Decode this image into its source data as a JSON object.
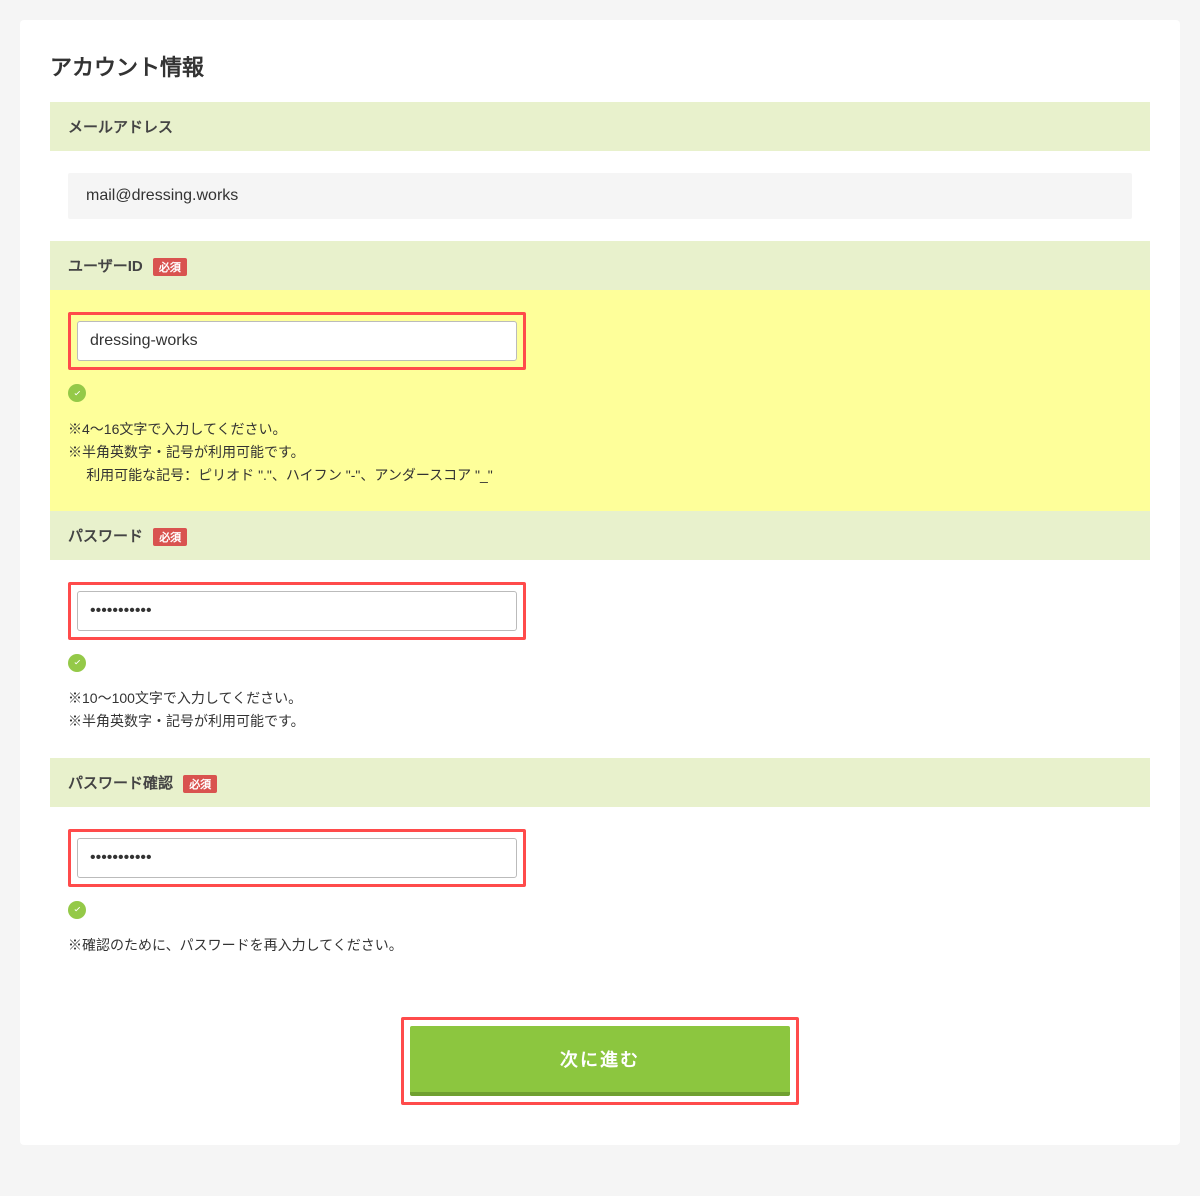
{
  "page_title": "アカウント情報",
  "required_label": "必須",
  "sections": {
    "email": {
      "label": "メールアドレス",
      "value": "mail@dressing.works"
    },
    "user_id": {
      "label": "ユーザーID",
      "required": true,
      "value": "dressing-works",
      "help": [
        "※4〜16文字で入力してください。",
        "※半角英数字・記号が利用可能です。",
        "利用可能な記号：ピリオド \".\"、ハイフン \"-\"、アンダースコア \"_\""
      ]
    },
    "password": {
      "label": "パスワード",
      "required": true,
      "value": "•••••••••••",
      "help": [
        "※10〜100文字で入力してください。",
        "※半角英数字・記号が利用可能です。"
      ]
    },
    "password_confirm": {
      "label": "パスワード確認",
      "required": true,
      "value": "•••••••••••",
      "help": [
        "※確認のために、パスワードを再入力してください。"
      ]
    }
  },
  "submit_label": "次に進む"
}
